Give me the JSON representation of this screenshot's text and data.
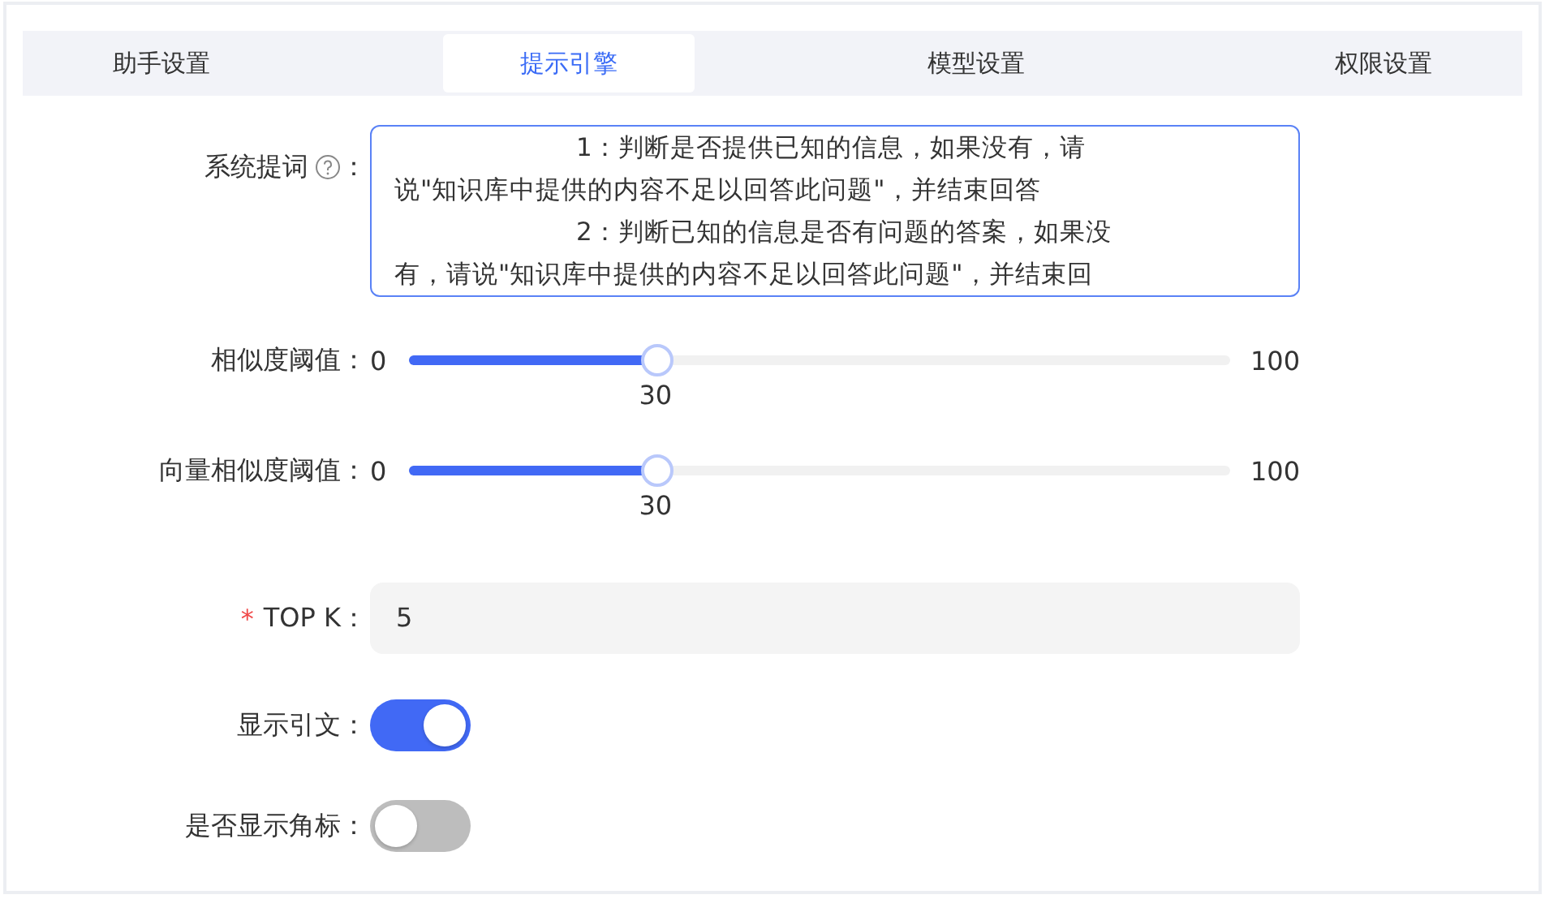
{
  "tabs": [
    {
      "label": "助手设置",
      "selected": false
    },
    {
      "label": "提示引擎",
      "selected": true
    },
    {
      "label": "模型设置",
      "selected": false
    },
    {
      "label": "权限设置",
      "selected": false
    }
  ],
  "fields": [
    {
      "kind": "textarea",
      "label": "系统提词",
      "help": true,
      "colon": "：",
      "lines": [
        "1：判断是否提供已知的信息，如果没有，请",
        "说\"知识库中提供的内容不足以回答此问题\"，并结束回答",
        "2：判断已知的信息是否有问题的答案，如果没",
        "有，请说\"知识库中提供的内容不足以回答此问题\"，并结束回"
      ]
    },
    {
      "kind": "slider",
      "label": "相似度阈值：",
      "min": "0",
      "max": "100",
      "value": "30",
      "level": 0.3
    },
    {
      "kind": "slider",
      "label": "向量相似度阈值：",
      "min": "0",
      "max": "100",
      "value": "30",
      "level": 0.3
    },
    {
      "kind": "input",
      "label": "TOP K：",
      "required_mark": "*",
      "value": "5"
    },
    {
      "kind": "switch",
      "label": "显示引文：",
      "on": true
    },
    {
      "kind": "switch",
      "label": "是否显示角标：",
      "on": false
    }
  ]
}
